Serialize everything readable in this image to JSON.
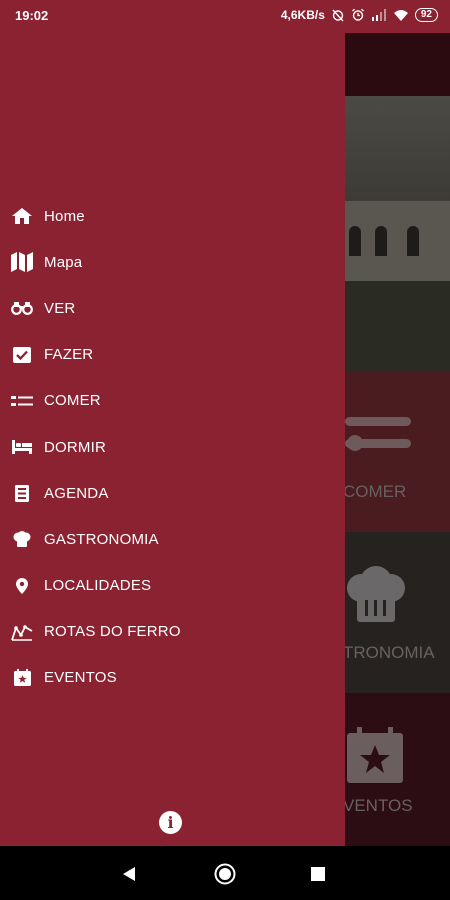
{
  "status_bar": {
    "time": "19:02",
    "network_speed": "4,6KB/s",
    "battery": "92"
  },
  "drawer": {
    "menu": [
      {
        "label": "Home",
        "icon": "home-icon"
      },
      {
        "label": "Mapa",
        "icon": "map-icon"
      },
      {
        "label": "VER",
        "icon": "binoculars-icon"
      },
      {
        "label": "FAZER",
        "icon": "checkbox-icon"
      },
      {
        "label": "COMER",
        "icon": "cutlery-icon"
      },
      {
        "label": "DORMIR",
        "icon": "bed-icon"
      },
      {
        "label": "AGENDA",
        "icon": "agenda-icon"
      },
      {
        "label": "GASTRONOMIA",
        "icon": "chef-hat-icon"
      },
      {
        "label": "LOCALIDADES",
        "icon": "map-pin-icon"
      },
      {
        "label": "ROTAS DO FERRO",
        "icon": "route-icon"
      },
      {
        "label": "EVENTOS",
        "icon": "calendar-star-icon"
      }
    ],
    "info_icon": "info-icon"
  },
  "background": {
    "tiles": [
      "COMER",
      "TRONOMIA",
      "VENTOS"
    ]
  },
  "colors": {
    "drawer": "#8a2232",
    "text": "#ffffff"
  }
}
